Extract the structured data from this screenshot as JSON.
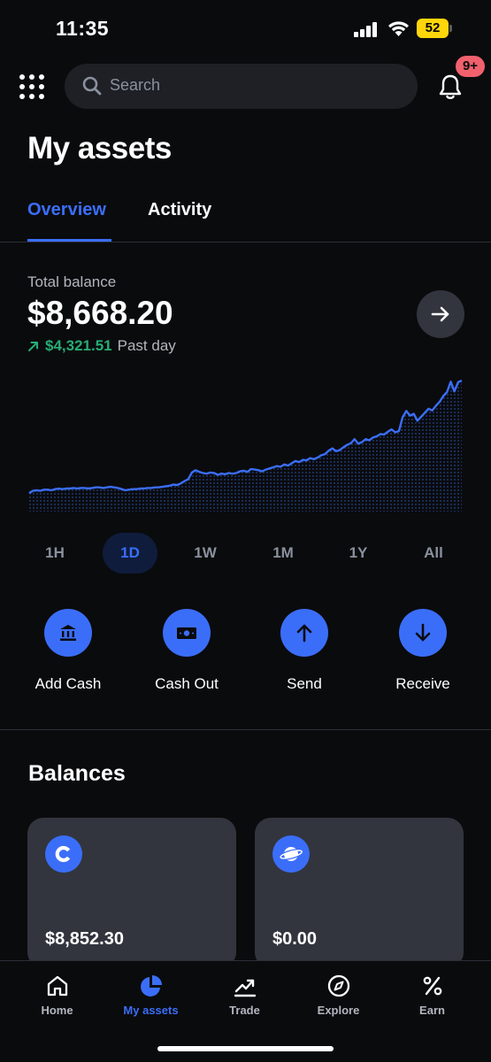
{
  "status_bar": {
    "time": "11:35",
    "battery": "52"
  },
  "header": {
    "search_placeholder": "Search",
    "notification_badge": "9+"
  },
  "page_title": "My assets",
  "tabs": [
    {
      "label": "Overview",
      "active": true
    },
    {
      "label": "Activity",
      "active": false
    }
  ],
  "balance": {
    "label": "Total balance",
    "value": "$8,668.20",
    "change": "$4,321.51",
    "period": "Past day"
  },
  "chart_data": {
    "type": "area",
    "title": "",
    "xlabel": "",
    "ylabel": "",
    "range": "1D",
    "color": "#3b6ef8",
    "values": [
      3.2,
      3.6,
      3.7,
      3.6,
      3.8,
      3.8,
      3.7,
      3.9,
      4.0,
      3.9,
      4.0,
      4.0,
      4.1,
      4.0,
      4.1,
      4.1,
      4.0,
      4.1,
      4.2,
      4.2,
      4.1,
      4.2,
      4.3,
      4.2,
      4.1,
      3.9,
      3.7,
      3.8,
      3.9,
      3.9,
      4.0,
      4.0,
      4.1,
      4.1,
      4.2,
      4.2,
      4.3,
      4.4,
      4.5,
      4.7,
      4.6,
      4.9,
      5.3,
      5.6,
      6.8,
      7.2,
      6.9,
      6.7,
      6.6,
      6.8,
      6.7,
      6.4,
      6.6,
      6.5,
      6.7,
      6.6,
      6.7,
      7.0,
      7.1,
      6.9,
      7.4,
      7.3,
      7.2,
      7.0,
      7.3,
      7.5,
      7.7,
      7.9,
      7.8,
      8.2,
      8.0,
      8.4,
      8.8,
      8.6,
      9.0,
      8.9,
      9.3,
      9.1,
      9.4,
      9.8,
      10.0,
      10.6,
      11.0,
      10.5,
      10.7,
      11.2,
      11.6,
      11.9,
      12.6,
      11.8,
      12.1,
      12.6,
      12.4,
      12.9,
      13.1,
      13.5,
      13.4,
      13.9,
      14.3,
      13.8,
      14.0,
      16.4,
      17.5,
      16.7,
      17.0,
      15.8,
      16.5,
      17.2,
      17.9,
      17.6,
      18.4,
      19.1,
      20.1,
      20.8,
      22.6,
      20.9,
      22.5,
      22.8
    ]
  },
  "time_ranges": [
    {
      "label": "1H",
      "active": false
    },
    {
      "label": "1D",
      "active": true
    },
    {
      "label": "1W",
      "active": false
    },
    {
      "label": "1M",
      "active": false
    },
    {
      "label": "1Y",
      "active": false
    },
    {
      "label": "All",
      "active": false
    }
  ],
  "actions": [
    {
      "label": "Add Cash",
      "icon": "bank-icon"
    },
    {
      "label": "Cash Out",
      "icon": "cash-icon"
    },
    {
      "label": "Send",
      "icon": "arrow-up-icon"
    },
    {
      "label": "Receive",
      "icon": "arrow-down-icon"
    }
  ],
  "balances_section": {
    "title": "Balances",
    "cards": [
      {
        "icon": "coinbase-icon",
        "amount": "$8,852.30"
      },
      {
        "icon": "planet-icon",
        "amount": "$0.00"
      }
    ]
  },
  "bottom_nav": [
    {
      "label": "Home",
      "icon": "home-icon",
      "active": false
    },
    {
      "label": "My assets",
      "icon": "pie-chart-icon",
      "active": true
    },
    {
      "label": "Trade",
      "icon": "trend-icon",
      "active": false
    },
    {
      "label": "Explore",
      "icon": "compass-icon",
      "active": false
    },
    {
      "label": "Earn",
      "icon": "percent-icon",
      "active": false
    }
  ],
  "colors": {
    "background": "#0a0b0d",
    "accent": "#3b6ef8",
    "positive": "#27ad75",
    "badge": "#f0616d",
    "card": "#32353d"
  }
}
